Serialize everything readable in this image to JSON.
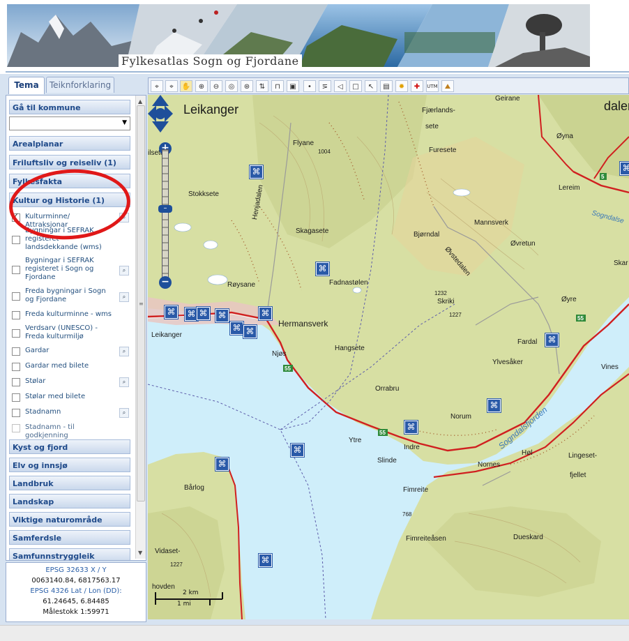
{
  "banner": {
    "title": "Fylkesatlas Sogn og Fjordane"
  },
  "tabs": [
    {
      "label": "Tema",
      "active": true
    },
    {
      "label": "Teiknforklaring",
      "active": false
    }
  ],
  "sections": {
    "go_to_municipality": "Gå til kommune",
    "municipality_select": {
      "value": ""
    },
    "top": [
      "Arealplanar",
      "Friluftsliv og reiseliv (1)",
      "Fylkesfakta",
      "Kultur og Historie (1)"
    ],
    "bottom": [
      "Kyst og fjord",
      "Elv og innsjø",
      "Landbruk",
      "Landskap",
      "Viktige naturområde",
      "Samferdsle",
      "Samfunnstryggleik"
    ]
  },
  "layers": [
    {
      "label": "Kulturminne/ Attraksjonar",
      "checked": true,
      "search": true
    },
    {
      "label": "Bygningar i SEFRAK registeret - landsdekkande (wms)",
      "checked": false,
      "search": false
    },
    {
      "label": "Bygningar i SEFRAK registeret i Sogn og Fjordane",
      "checked": false,
      "search": true
    },
    {
      "label": "Freda bygningar i Sogn og Fjordane",
      "checked": false,
      "search": true
    },
    {
      "label": "Freda kulturminne - wms",
      "checked": false,
      "search": false
    },
    {
      "label": "Verdsarv (UNESCO) - Freda kulturmiljø",
      "checked": false,
      "search": false
    },
    {
      "label": "Gardar",
      "checked": false,
      "search": true
    },
    {
      "label": "Gardar med bilete",
      "checked": false,
      "search": false
    },
    {
      "label": "Stølar",
      "checked": false,
      "search": true
    },
    {
      "label": "Stølar med bilete",
      "checked": false,
      "search": false
    },
    {
      "label": "Stadnamn",
      "checked": false,
      "search": true
    },
    {
      "label": "Stadnamn - til godkjenning",
      "checked": false,
      "search": false
    }
  ],
  "coords": {
    "epsg1_label": "EPSG 32633 X / Y",
    "epsg1_value": "0063140.84, 6817563.17",
    "epsg2_label": "EPSG 4326 Lat / Lon (DD):",
    "epsg2_value": "61.24645, 6.84485",
    "scale": "Målestokk 1:59971"
  },
  "toolbar": {
    "icons": [
      "binoculars-icon",
      "binoculars-all-icon",
      "pan-hand-icon",
      "zoom-in-icon",
      "zoom-out-icon",
      "zoom-extent-icon",
      "zoom-scale-icon",
      "refresh-icon",
      "measure-icon",
      "info-icon",
      "point-icon",
      "line-icon",
      "polygon-icon",
      "rectangle-icon",
      "select-icon",
      "print-icon",
      "sun-icon",
      "red-cross-icon",
      "utm-icon",
      "landscape-icon"
    ],
    "utm_label": "UTM"
  },
  "map": {
    "places": [
      {
        "name": "Leikanger",
        "cls": "huge"
      },
      {
        "name": "Fjærlands-"
      },
      {
        "name": "sete"
      },
      {
        "name": "Geirane"
      },
      {
        "name": "dalen",
        "cls": "huge"
      },
      {
        "name": "Flyane"
      },
      {
        "name": "1004"
      },
      {
        "name": "Furesete"
      },
      {
        "name": "Øyna"
      },
      {
        "name": "ilsete"
      },
      {
        "name": "Lereim"
      },
      {
        "name": "Stokksete"
      },
      {
        "name": "Henjadalen"
      },
      {
        "name": "Sogndalse"
      },
      {
        "name": "Skagasete"
      },
      {
        "name": "Bjørndal"
      },
      {
        "name": "Mannsverk"
      },
      {
        "name": "Øvretun"
      },
      {
        "name": "Øvstedalen"
      },
      {
        "name": "Fadnastølen"
      },
      {
        "name": "Skar"
      },
      {
        "name": "1232"
      },
      {
        "name": "Skriki"
      },
      {
        "name": "1227"
      },
      {
        "name": "Røysane"
      },
      {
        "name": "Øyre"
      },
      {
        "name": "Hermansverk",
        "cls": "big"
      },
      {
        "name": "Leikanger"
      },
      {
        "name": "Fardal"
      },
      {
        "name": "Njøs"
      },
      {
        "name": "Hangsete"
      },
      {
        "name": "Ylvesåker"
      },
      {
        "name": "Vines"
      },
      {
        "name": "Orrabru"
      },
      {
        "name": "Norum"
      },
      {
        "name": "Sogndalsfjorden",
        "cls": "water"
      },
      {
        "name": "Ytre"
      },
      {
        "name": "Indre"
      },
      {
        "name": "Slinde"
      },
      {
        "name": "Nornes"
      },
      {
        "name": "Høl"
      },
      {
        "name": "Lingeset-"
      },
      {
        "name": "fjellet"
      },
      {
        "name": "Bårlog"
      },
      {
        "name": "Fimreite"
      },
      {
        "name": "768"
      },
      {
        "name": "Fimreiteåsen"
      },
      {
        "name": "Dueskard"
      },
      {
        "name": "Vidaset-"
      },
      {
        "name": "1227"
      },
      {
        "name": "hovden"
      }
    ],
    "road_labels": [
      "55",
      "55",
      "55",
      "55",
      "5"
    ],
    "scalebar": {
      "km": "2 km",
      "mi": "1 mi"
    }
  },
  "colors": {
    "highlight_circle": "#e01818",
    "panel_text": "#1f4a8a",
    "water": "#cfeefa",
    "land": "#d3dca0"
  }
}
